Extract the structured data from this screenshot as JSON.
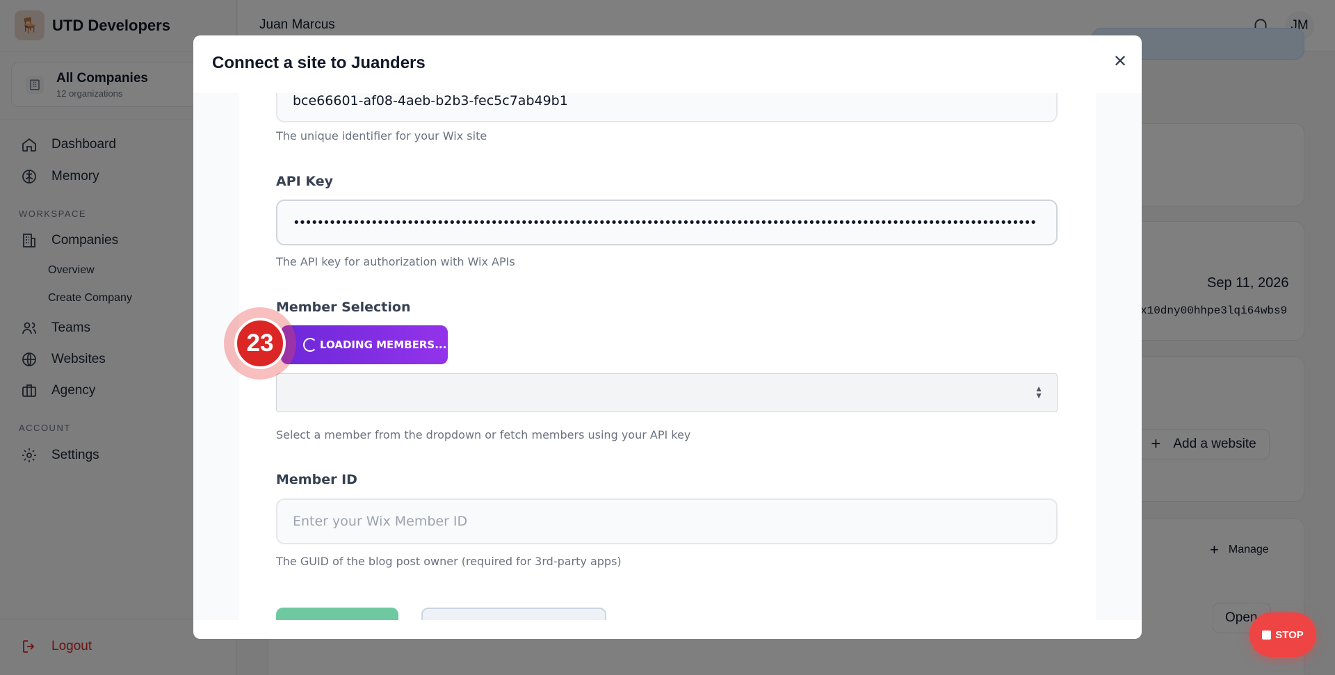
{
  "sidebar": {
    "brand_name": "UTD Developers",
    "company_switcher": {
      "title": "All Companies",
      "subtitle": "12 organizations"
    },
    "nav": {
      "dashboard": "Dashboard",
      "memory": "Memory"
    },
    "workspace_label": "WORKSPACE",
    "workspace": {
      "companies": "Companies",
      "overview": "Overview",
      "create_company": "Create Company",
      "teams": "Teams",
      "websites": "Websites",
      "agency": "Agency"
    },
    "account_label": "ACCOUNT",
    "settings": "Settings",
    "logout": "Logout"
  },
  "header": {
    "user_name": "Juan Marcus",
    "avatar_initials": "JM"
  },
  "background": {
    "date": "Sep 11, 2026",
    "code": "x10dny00hhpe3lqi64wbs9",
    "add_website": "Add a website",
    "manage": "Manage",
    "open": "Open"
  },
  "modal": {
    "title": "Connect a site to Juanders",
    "site_id_value": "bce66601-af08-4aeb-b2b3-fec5c7ab49b1",
    "site_id_help": "The unique identifier for your Wix site",
    "api_key_label": "API Key",
    "api_key_value": "••••••••••••••••••••••••••••••••••••••••••••••••••••••••••••••••••••••••••••••••••••••••••••••••••••••••••••••••••••••••••••",
    "api_key_help": "The API key for authorization with Wix APIs",
    "member_selection_label": "Member Selection",
    "loading_members": "LOADING MEMBERS...",
    "member_select_help": "Select a member from the dropdown or fetch members using your API key",
    "member_id_label": "Member ID",
    "member_id_placeholder": "Enter your Wix Member ID",
    "member_id_help": "The GUID of the blog post owner (required for 3rd-party apps)"
  },
  "step_badge": "23",
  "stop_label": "STOP"
}
